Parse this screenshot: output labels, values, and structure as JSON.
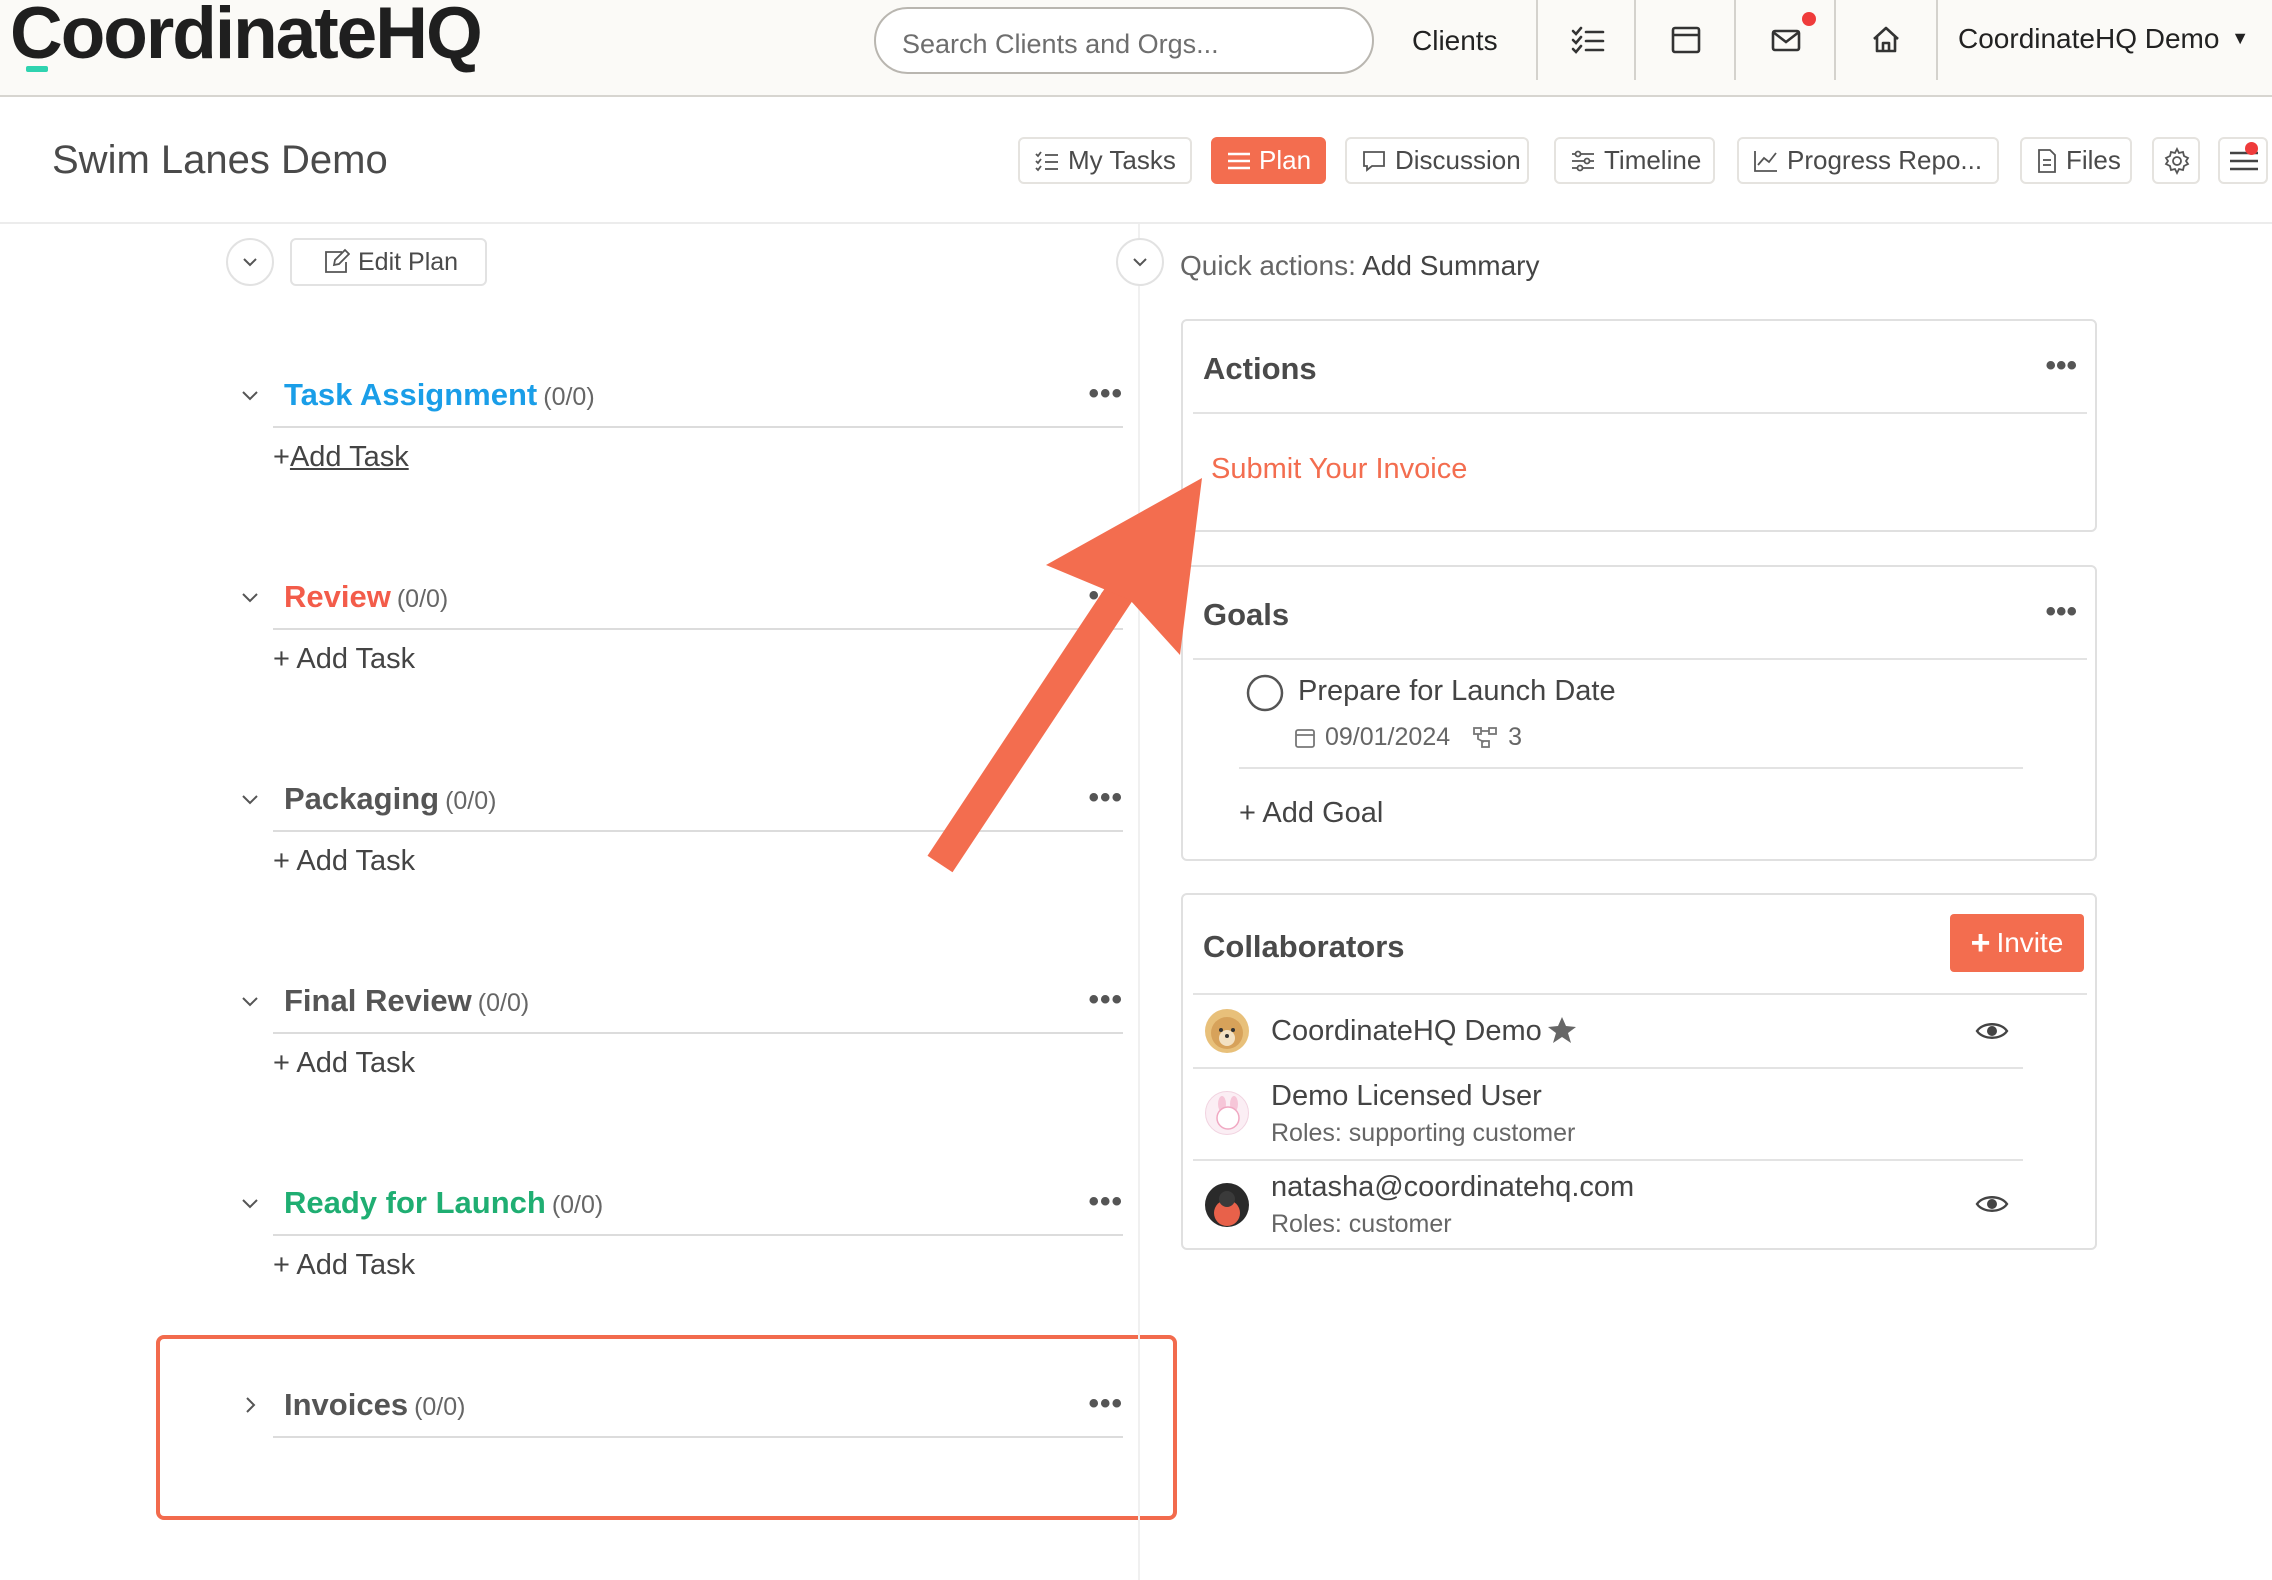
{
  "nav": {
    "logo_text": "CoordinateHQ",
    "search_placeholder": "Search Clients and Orgs...",
    "clients_label": "Clients",
    "account_label": "CoordinateHQ Demo",
    "icons": [
      "tasks-list-icon",
      "calendar-icon",
      "mail-icon",
      "home-icon",
      "caret-down-icon"
    ]
  },
  "project": {
    "title": "Swim Lanes Demo",
    "tabs": [
      {
        "label": "My Tasks",
        "icon": "checklist-icon"
      },
      {
        "label": "Plan",
        "icon": "lines-icon",
        "active": true
      },
      {
        "label": "Discussion",
        "icon": "chat-icon"
      },
      {
        "label": "Timeline",
        "icon": "sliders-icon"
      },
      {
        "label": "Progress Repo...",
        "icon": "chart-icon"
      },
      {
        "label": "Files",
        "icon": "file-icon"
      }
    ]
  },
  "plan": {
    "edit_label": "Edit Plan",
    "add_task_label": "Add Task",
    "lanes": [
      {
        "name": "Task Assignment",
        "count": "(0/0)",
        "color": "#1a9ee8"
      },
      {
        "name": "Review",
        "count": "(0/0)",
        "color": "#f35c4a"
      },
      {
        "name": "Packaging",
        "count": "(0/0)",
        "color": "#555555"
      },
      {
        "name": "Final Review",
        "count": "(0/0)",
        "color": "#555555"
      },
      {
        "name": "Ready for Launch",
        "count": "(0/0)",
        "color": "#1fae72"
      },
      {
        "name": "Invoices",
        "count": "(0/0)",
        "color": "#555555"
      }
    ]
  },
  "right": {
    "quick_prefix": "Quick actions:",
    "quick_action": "Add Summary",
    "actions": {
      "title": "Actions",
      "item": "Submit Your Invoice"
    },
    "goals": {
      "title": "Goals",
      "goal": "Prepare for Launch Date",
      "date": "09/01/2024",
      "subcount": "3",
      "add_label": "Add Goal"
    },
    "collaborators": {
      "title": "Collaborators",
      "invite_label": "Invite",
      "people": [
        {
          "name": "CoordinateHQ Demo",
          "role": ""
        },
        {
          "name": "Demo Licensed User",
          "role": "Roles: supporting customer"
        },
        {
          "name": "natasha@coordinatehq.com",
          "role": "Roles: customer"
        }
      ]
    }
  },
  "colors": {
    "accent": "#f36d4f",
    "highlight": "#f26b4d"
  }
}
